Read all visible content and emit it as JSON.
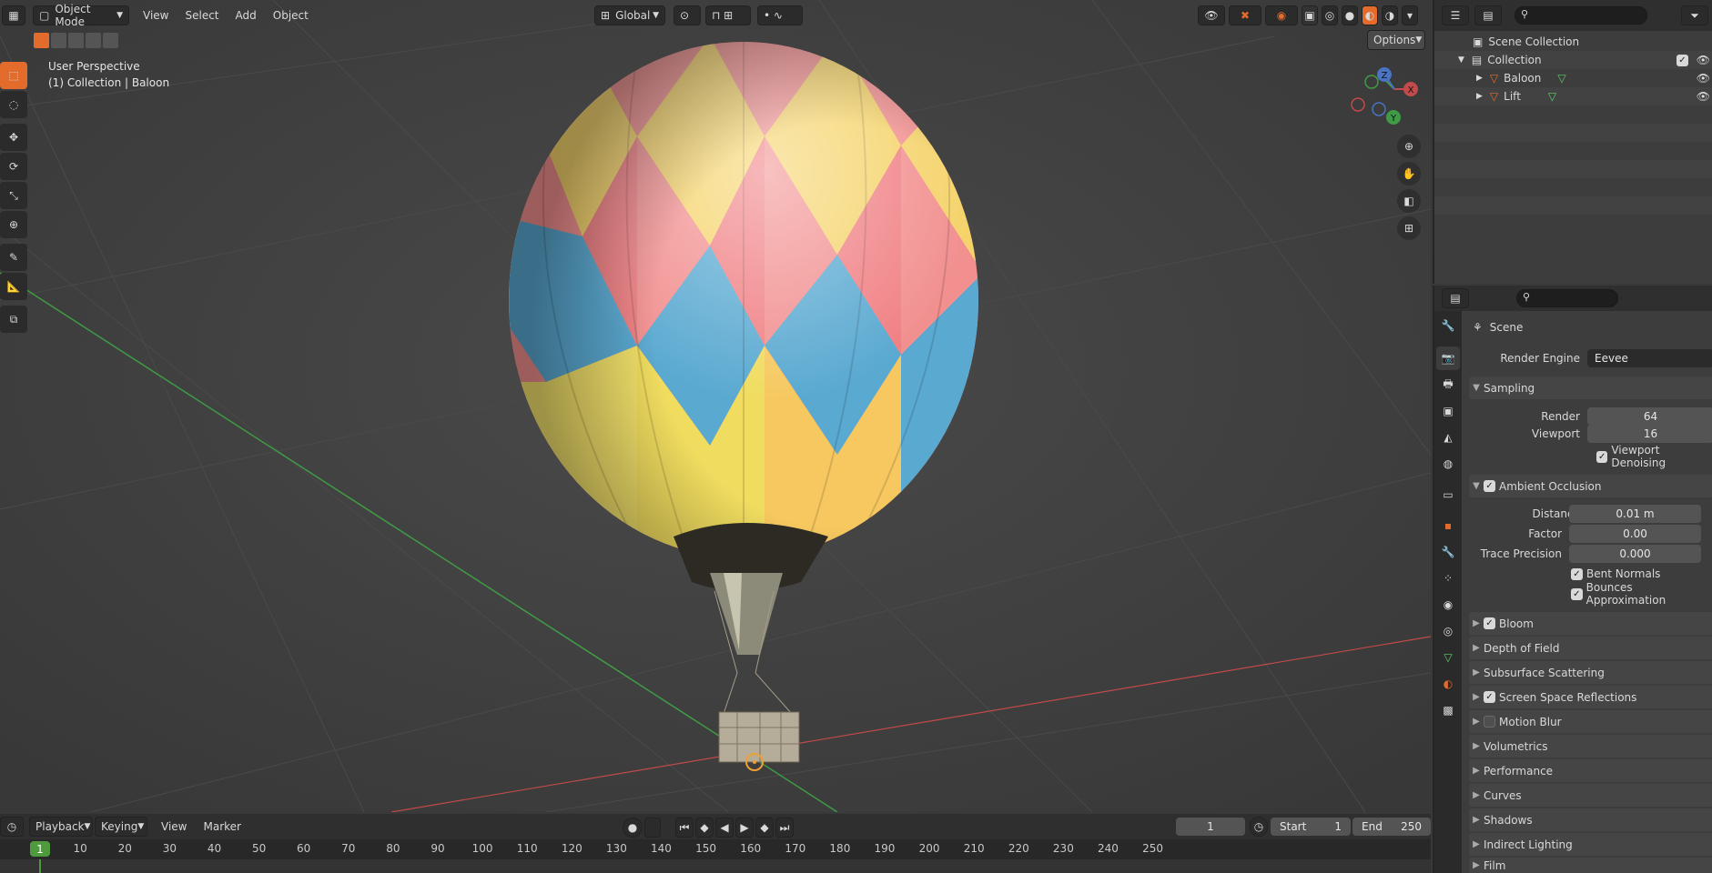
{
  "viewport": {
    "header": {
      "mode": "Object Mode",
      "menus": [
        "View",
        "Select",
        "Add",
        "Object"
      ],
      "orientation": "Global",
      "options_label": "Options"
    },
    "overlay": {
      "perspective": "User Perspective",
      "context": "(1) Collection | Baloon"
    },
    "gizmo": {
      "x": "X",
      "y": "Y",
      "z": "Z"
    },
    "nav_icons": [
      "zoom-icon",
      "hand-icon",
      "camera-icon",
      "grid-icon"
    ],
    "tools": [
      "select-box-icon",
      "cursor-icon",
      "move-icon",
      "rotate-icon",
      "scale-icon",
      "transform-icon",
      "annotate-icon",
      "measure-icon",
      "add-cube-icon"
    ]
  },
  "outliner": {
    "scene_collection": "Scene Collection",
    "collection": "Collection",
    "objects": [
      {
        "name": "Baloon"
      },
      {
        "name": "Lift"
      }
    ]
  },
  "properties": {
    "context": "Scene",
    "render_engine_label": "Render Engine",
    "render_engine": "Eevee",
    "sampling": {
      "title": "Sampling",
      "render_label": "Render",
      "render": "64",
      "viewport_label": "Viewport",
      "viewport": "16",
      "denoise": "Viewport Denoising"
    },
    "ao": {
      "title": "Ambient Occlusion",
      "distance_label": "Distance",
      "distance": "0.01 m",
      "factor_label": "Factor",
      "factor": "0.00",
      "trace_label": "Trace Precision",
      "trace": "0.000",
      "bent_normals": "Bent Normals",
      "bounces": "Bounces Approximation"
    },
    "panels": [
      {
        "label": "Bloom",
        "checkbox": true,
        "checked": true
      },
      {
        "label": "Depth of Field",
        "checkbox": false
      },
      {
        "label": "Subsurface Scattering",
        "checkbox": false
      },
      {
        "label": "Screen Space Reflections",
        "checkbox": true,
        "checked": true
      },
      {
        "label": "Motion Blur",
        "checkbox": true,
        "checked": false
      },
      {
        "label": "Volumetrics",
        "checkbox": false
      },
      {
        "label": "Performance",
        "checkbox": false
      },
      {
        "label": "Curves",
        "checkbox": false
      },
      {
        "label": "Shadows",
        "checkbox": false
      },
      {
        "label": "Indirect Lighting",
        "checkbox": false
      },
      {
        "label": "Film",
        "checkbox": false
      }
    ]
  },
  "timeline": {
    "menus": [
      "Playback",
      "Keying",
      "View",
      "Marker"
    ],
    "current_frame": "1",
    "start_label": "Start",
    "start": "1",
    "end_label": "End",
    "end": "250",
    "ticks": [
      "1",
      "10",
      "20",
      "30",
      "40",
      "50",
      "60",
      "70",
      "80",
      "90",
      "100",
      "110",
      "120",
      "130",
      "140",
      "150",
      "160",
      "170",
      "180",
      "190",
      "200",
      "210",
      "220",
      "230",
      "240",
      "250"
    ]
  },
  "colors": {
    "accent": "#e36c2d",
    "frame_green": "#4e9a3c",
    "x_axis": "#c24a4a",
    "y_axis": "#3f9b45"
  }
}
